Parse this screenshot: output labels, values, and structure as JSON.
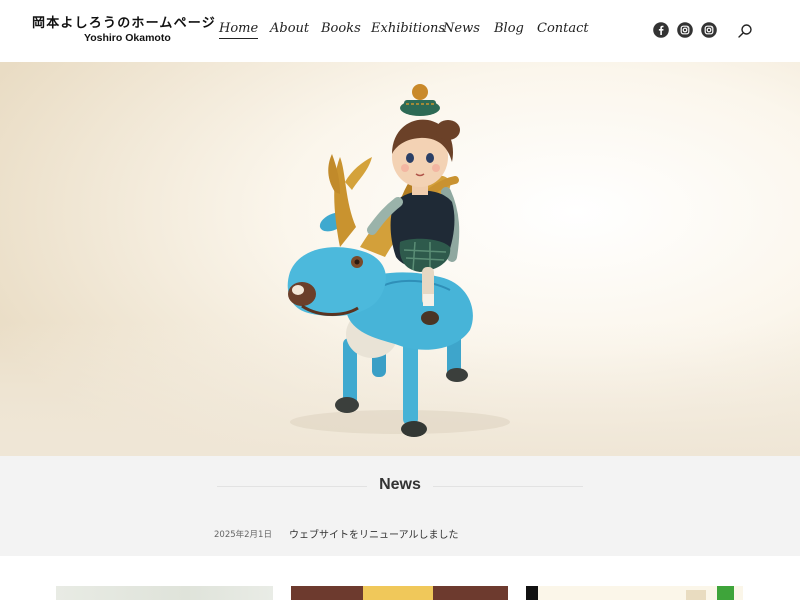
{
  "site": {
    "logo_jp": "岡本よしろうのホームページ",
    "logo_en": "Yoshiro Okamoto"
  },
  "nav": {
    "items": [
      {
        "label": "Home",
        "active": true
      },
      {
        "label": "About",
        "active": false
      },
      {
        "label": "Books",
        "active": false
      },
      {
        "label": "Exhibitions",
        "active": false
      },
      {
        "label": "News",
        "active": false
      },
      {
        "label": "Blog",
        "active": false
      },
      {
        "label": "Contact",
        "active": false
      }
    ]
  },
  "social": {
    "icons": [
      "facebook-icon",
      "instagram-icon",
      "instagram-icon"
    ],
    "color": "#333333"
  },
  "search": {
    "icon": "search-icon"
  },
  "news": {
    "title": "News",
    "items": [
      {
        "date": "2025年2月1日",
        "text": "ウェブサイトをリニューアルしました"
      }
    ]
  },
  "colors": {
    "news_background": "#f3f3f3",
    "deer_blue": "#45b3d6",
    "antler_gold": "#c9932f"
  }
}
